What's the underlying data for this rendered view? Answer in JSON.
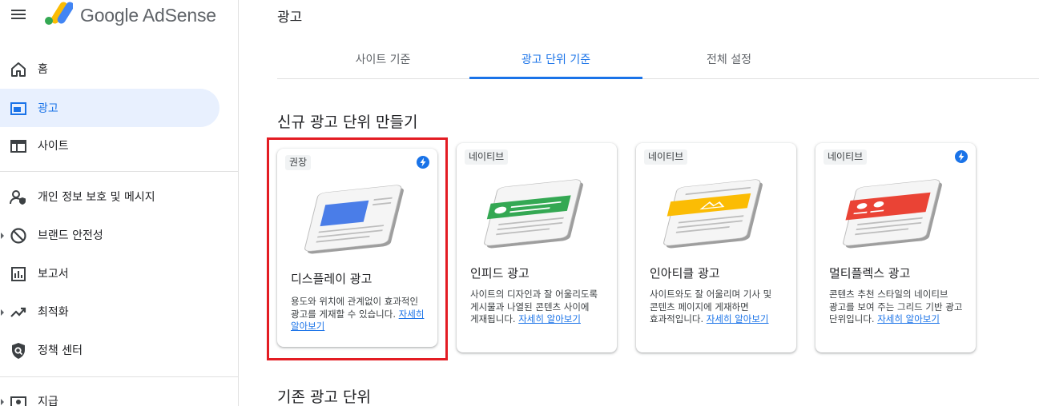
{
  "header": {
    "brand": "Google AdSense",
    "page_title": "광고"
  },
  "sidebar": {
    "items": [
      {
        "label": "홈",
        "icon": "home-icon"
      },
      {
        "label": "광고",
        "icon": "ads-icon",
        "active": true
      },
      {
        "label": "사이트",
        "icon": "sites-icon"
      },
      {
        "label": "개인 정보 보호 및 메시지",
        "icon": "privacy-icon"
      },
      {
        "label": "브랜드 안전성",
        "icon": "block-icon",
        "expandable": true
      },
      {
        "label": "보고서",
        "icon": "reports-icon"
      },
      {
        "label": "최적화",
        "icon": "trending-icon",
        "expandable": true
      },
      {
        "label": "정책 센터",
        "icon": "policy-icon"
      },
      {
        "label": "지급",
        "icon": "payments-icon",
        "expandable": true
      }
    ]
  },
  "tabs": [
    {
      "label": "사이트 기준"
    },
    {
      "label": "광고 단위 기준",
      "active": true
    },
    {
      "label": "전체 설정"
    }
  ],
  "sections": {
    "new_title": "신규 광고 단위 만들기",
    "existing_title": "기존 광고 단위"
  },
  "cards": [
    {
      "badge": "권장",
      "title": "디스플레이 광고",
      "desc": "용도와 위치에 관계없이 효과적인 광고를 게재할 수 있습니다.",
      "link": "자세히 알아보기",
      "color": "#4285f4",
      "bolt": true
    },
    {
      "badge": "네이티브",
      "title": "인피드 광고",
      "desc": "사이트의 디자인과 잘 어울리도록 게시물과 나열된 콘텐츠 사이에 게재됩니다.",
      "link": "자세히 알아보기",
      "color": "#34a853",
      "bolt": false
    },
    {
      "badge": "네이티브",
      "title": "인아티클 광고",
      "desc": "사이트와도 잘 어울리며 기사 및 콘텐츠 페이지에 게재하면 효과적입니다.",
      "link": "자세히 알아보기",
      "color": "#fbbc04",
      "bolt": false
    },
    {
      "badge": "네이티브",
      "title": "멀티플렉스 광고",
      "desc": "콘텐츠 추천 스타일의 네이티브 광고를 보여 주는 그리드 기반 광고 단위입니다.",
      "link": "자세히 알아보기",
      "color": "#ea4335",
      "bolt": true
    }
  ],
  "colors": {
    "accent": "#1a73e8",
    "highlight_border": "#e31c23"
  }
}
